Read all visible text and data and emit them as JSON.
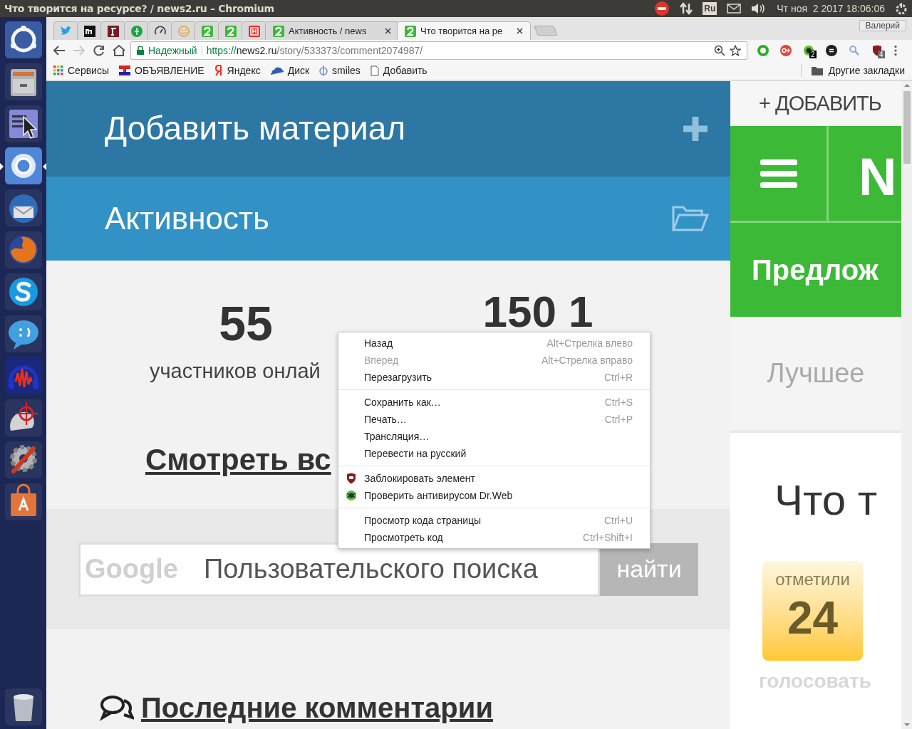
{
  "top_panel": {
    "title": "Что творится на ресурсе? / news2.ru – Chromium",
    "keyboard_layout": "Ru",
    "clock": "Чт ноя  2 2017 18:06:06"
  },
  "launcher": [
    {
      "focused": false
    },
    {
      "focused": false
    },
    {
      "focused": false
    },
    {
      "focused": true
    },
    {
      "focused": false
    },
    {
      "focused": false
    },
    {
      "focused": false
    },
    {
      "focused": false
    },
    {
      "focused": false
    },
    {
      "focused": false
    },
    {
      "focused": false
    },
    {
      "focused": false
    }
  ],
  "tabs": [
    {
      "selected": false
    },
    {
      "selected": false
    },
    {
      "selected": false
    },
    {
      "selected": false
    },
    {
      "selected": false
    },
    {
      "selected": false
    },
    {
      "selected": false
    },
    {
      "selected": false
    },
    {
      "selected": false
    },
    {
      "title": "Активность / news",
      "selected": false
    },
    {
      "title": "Что творится на ре",
      "selected": true
    }
  ],
  "profile": "Валерий",
  "address_bar": {
    "security": "Надежный",
    "scheme": "https://",
    "host": "news2.ru",
    "path": "/story/533373/comment2074987/"
  },
  "extensions": [
    {
      "kind": "ring"
    },
    {
      "kind": "social"
    },
    {
      "kind": "antivirus",
      "badge": "2"
    },
    {
      "kind": "reader"
    },
    {
      "kind": "search"
    },
    {
      "kind": "blocker",
      "badge": "4"
    }
  ],
  "bookmarks": [
    "Сервисы",
    "ОБЪЯВЛЕНИЕ",
    "Яндекс",
    "Диск",
    "smiles",
    "Добавить"
  ],
  "other_bookmarks": "Другие закладки",
  "page": {
    "add_material": "Добавить материал",
    "activity": "Активность",
    "stats": [
      {
        "value": "55",
        "label": "участников онлай"
      },
      {
        "value": "150 1"
      }
    ],
    "view_all": "Смотреть вс",
    "search": {
      "logo": "Google",
      "placeholder": "Пользовательского поиска",
      "button": "найти"
    },
    "latest_comments": "Последние комментарии"
  },
  "sidebar": {
    "add": "+ ДОБАВИТЬ",
    "logo": "N",
    "propose": "Предлож",
    "best": "Лучшее",
    "heading": "Что т",
    "votes_label": "отметили",
    "votes": "24",
    "vote": "голосовать"
  },
  "context_menu": [
    [
      {
        "label": "Назад",
        "shortcut": "Alt+Стрелка влево",
        "disabled": false,
        "kind": "plain"
      },
      {
        "label": "Вперед",
        "shortcut": "Alt+Стрелка вправо",
        "disabled": true,
        "kind": "plain"
      },
      {
        "label": "Перезагрузить",
        "shortcut": "Ctrl+R",
        "disabled": false,
        "kind": "plain"
      }
    ],
    [
      {
        "label": "Сохранить как…",
        "shortcut": "Ctrl+S",
        "disabled": false,
        "kind": "plain"
      },
      {
        "label": "Печать…",
        "shortcut": "Ctrl+P",
        "disabled": false,
        "kind": "plain"
      },
      {
        "label": "Трансляция…",
        "disabled": false,
        "kind": "plain"
      },
      {
        "label": "Перевести на русский",
        "disabled": false,
        "kind": "plain"
      }
    ],
    [
      {
        "label": "Заблокировать элемент",
        "disabled": false,
        "kind": "extension"
      },
      {
        "label": "Проверить антивирусом Dr.Web",
        "disabled": false,
        "kind": "extension"
      }
    ],
    [
      {
        "label": "Просмотр кода страницы",
        "shortcut": "Ctrl+U",
        "disabled": false,
        "kind": "plain"
      },
      {
        "label": "Просмотреть код",
        "shortcut": "Ctrl+Shift+I",
        "disabled": false,
        "kind": "plain"
      }
    ]
  ]
}
